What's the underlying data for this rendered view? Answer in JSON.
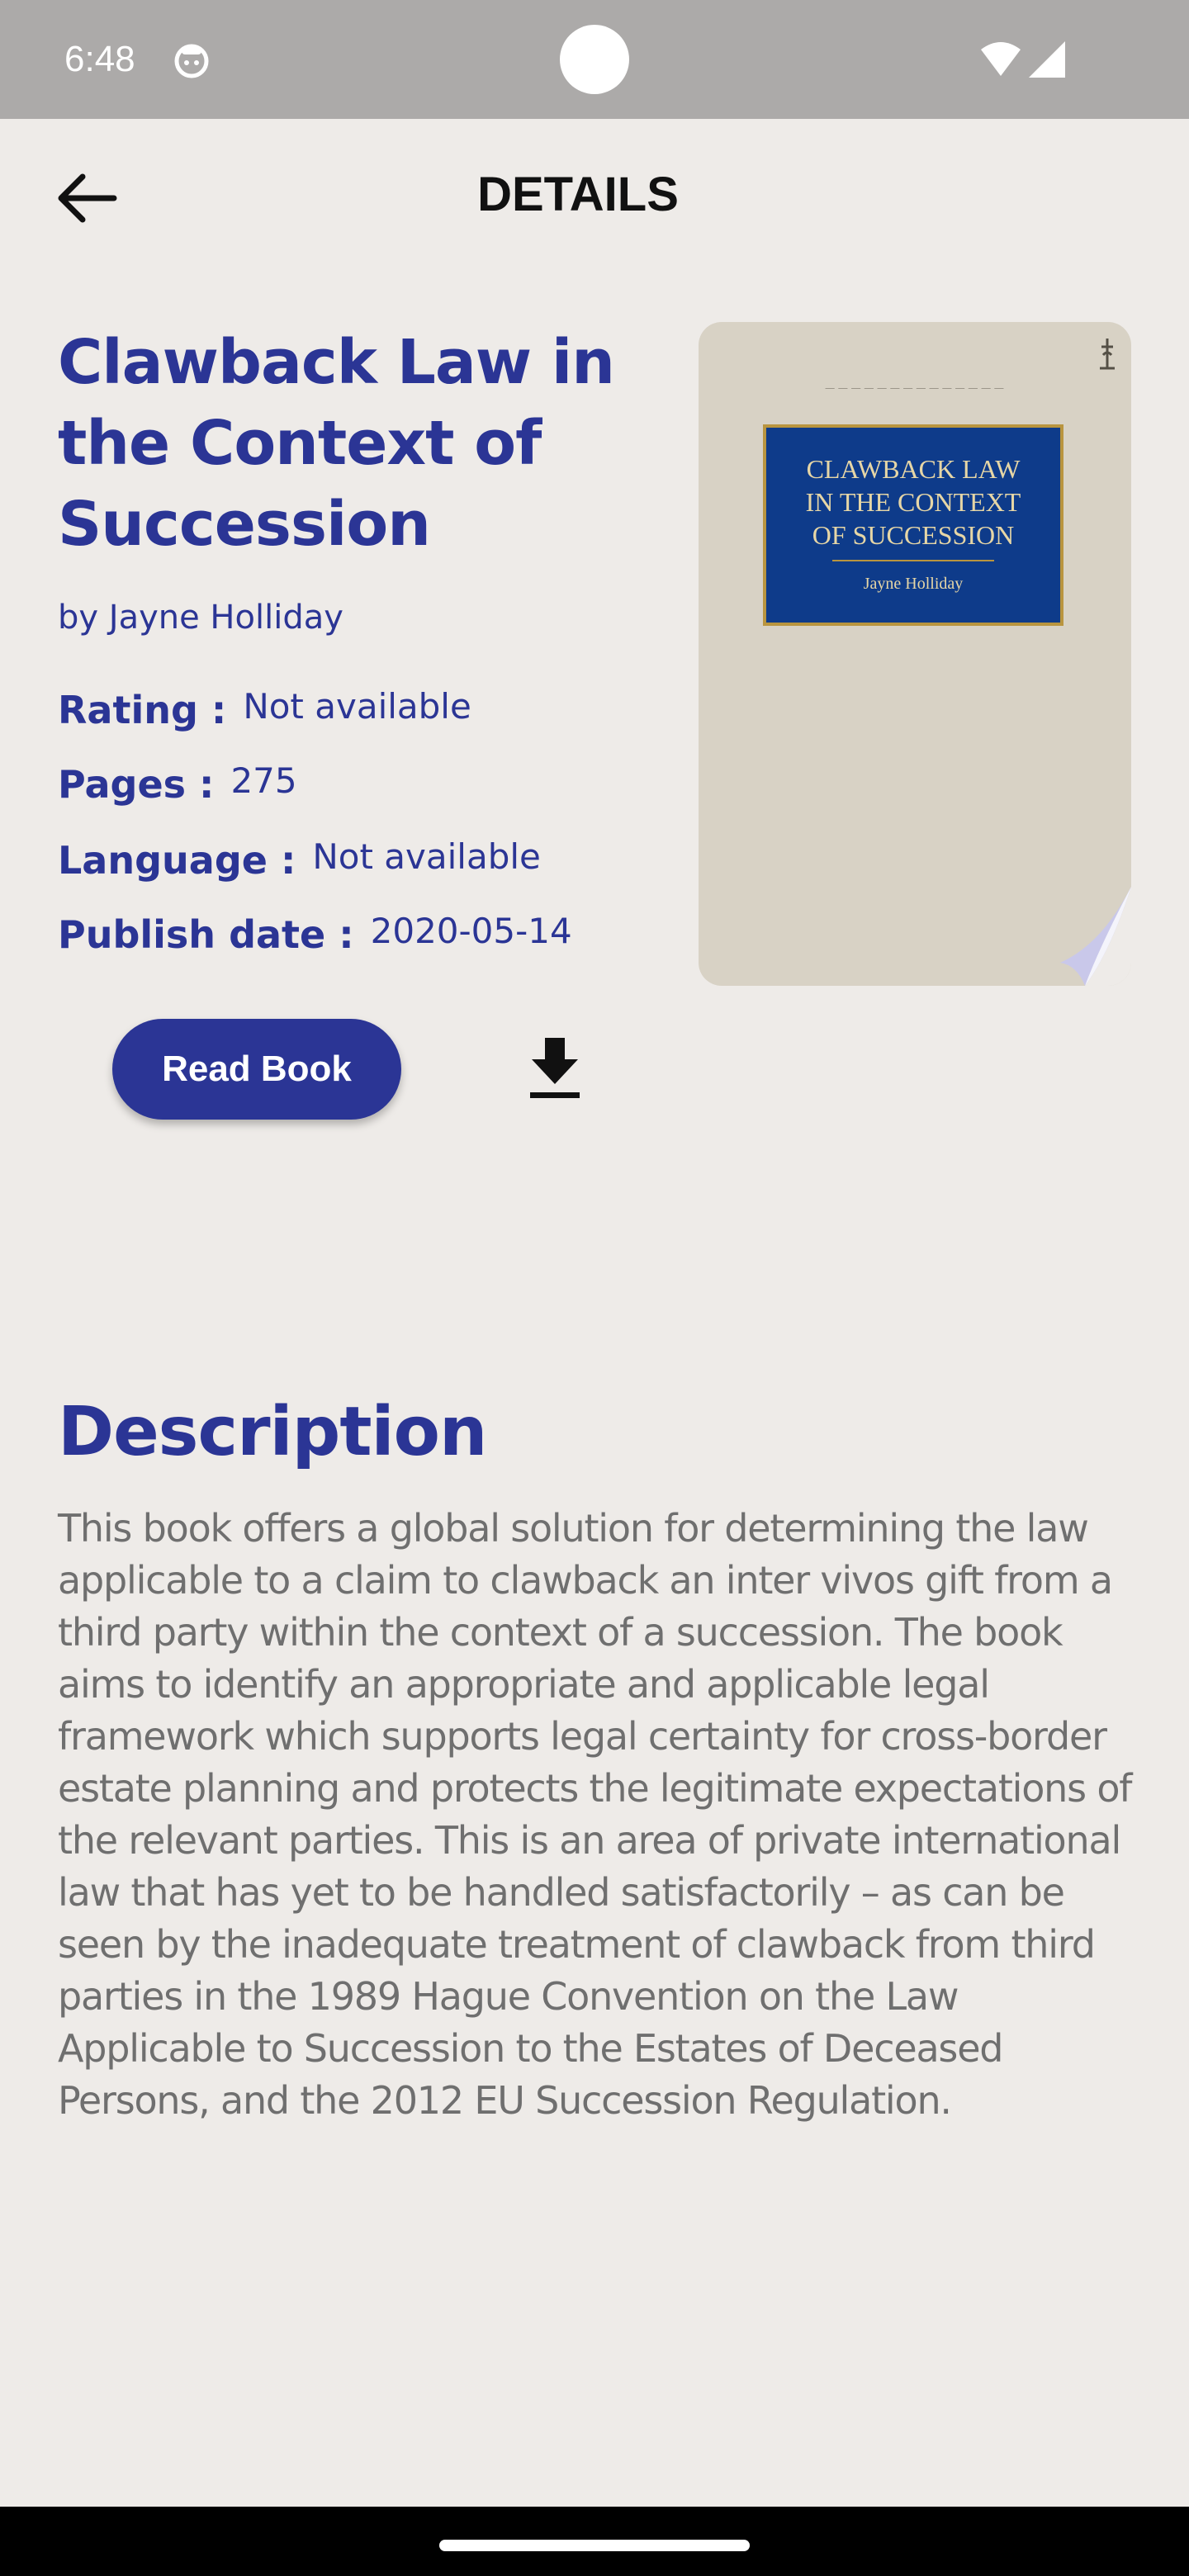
{
  "status_bar": {
    "time": "6:48",
    "icons": [
      "notification-icon",
      "wifi-icon",
      "signal-icon"
    ]
  },
  "app_bar": {
    "title": "DETAILS",
    "back_icon": "arrow-left-icon"
  },
  "book": {
    "title": "Clawback Law in the Context of Succession",
    "author": "by Jayne Holliday",
    "rating_label": "Rating :",
    "rating_value": "Not available",
    "pages_label": "Pages :",
    "pages_value": "275",
    "language_label": "Language :",
    "language_value": "Not available",
    "publish_label": "Publish date :",
    "publish_value": "2020-05-14"
  },
  "cover": {
    "panel_title": "CLAWBACK LAW\nIN THE CONTEXT\nOF SUCCESSION",
    "panel_author": "Jayne Holliday",
    "background_color": "#d8d2c5",
    "panel_color": "#0e3b8a"
  },
  "actions": {
    "read_label": "Read Book",
    "download_icon": "download-icon"
  },
  "description": {
    "heading": "Description",
    "text": "This book offers a global solution for determining the law applicable to a claim to clawback an inter vivos gift from a third party within the context of a succession. The book aims to identify an appropriate and applicable legal framework which supports legal certainty for cross-border estate planning and protects the legitimate expectations of the relevant parties. This is an area of private international law that has yet to be handled satisfactorily – as can be seen by the inadequate treatment of clawback from third parties in the 1989 Hague Convention on the Law Applicable to Succession to the Estates of Deceased Persons, and the 2012 EU Succession Regulation."
  },
  "colors": {
    "accent": "#2b3595",
    "background": "#eeebe8",
    "status_bar": "#acaaa9",
    "body_text": "#6f6f6f"
  }
}
